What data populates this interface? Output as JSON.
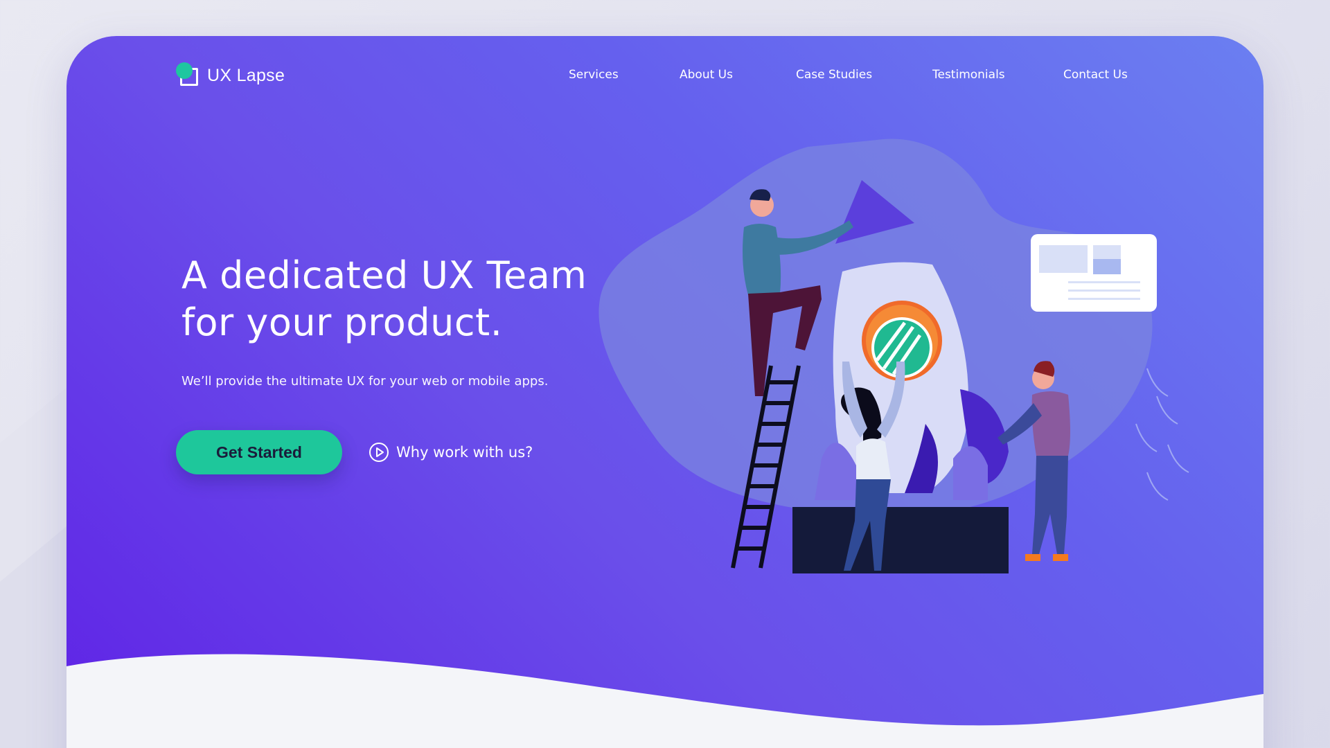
{
  "brand": {
    "name": "UX Lapse",
    "accent_color": "#1ec79b",
    "hero_gradient": [
      "#5f23e6",
      "#6a4fea",
      "#6b7ff1"
    ]
  },
  "nav": {
    "items": [
      {
        "label": "Services"
      },
      {
        "label": "About Us"
      },
      {
        "label": "Case Studies"
      },
      {
        "label": "Testimonials"
      },
      {
        "label": "Contact Us"
      }
    ]
  },
  "hero": {
    "headline_line1": "A dedicated UX Team",
    "headline_line2": "for your product.",
    "subtitle": "We’ll provide the ultimate UX for your web or mobile apps.",
    "cta_label": "Get Started",
    "secondary_label": "Why work with us?",
    "secondary_icon": "play-circle-icon"
  },
  "illustration": {
    "icons": [
      "rocket-icon",
      "ladder-icon",
      "people-icon",
      "browser-card-icon",
      "target-badge-icon"
    ]
  }
}
